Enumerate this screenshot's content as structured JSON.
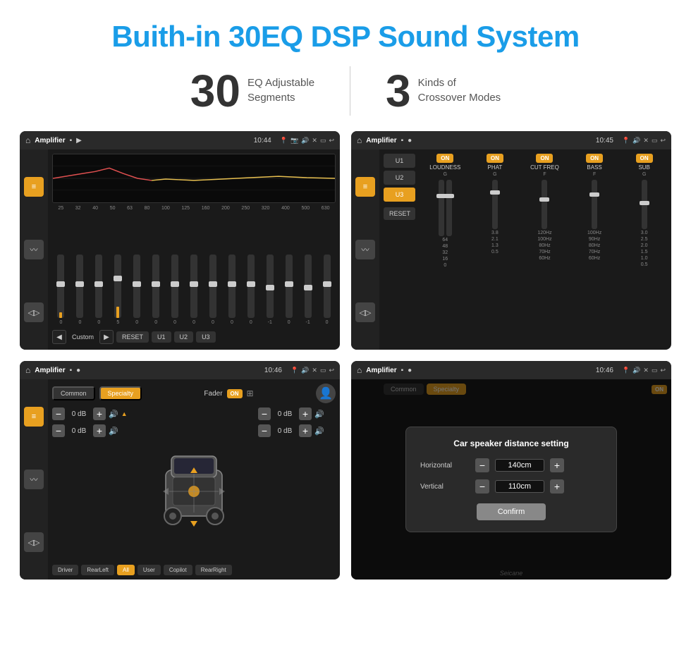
{
  "header": {
    "title": "Buith-in 30EQ DSP Sound System"
  },
  "stats": [
    {
      "number": "30",
      "text": "EQ Adjustable\nSegments"
    },
    {
      "number": "3",
      "text": "Kinds of\nCrossover Modes"
    }
  ],
  "screens": {
    "eq": {
      "topbar": {
        "title": "Amplifier",
        "time": "10:44"
      },
      "freq_labels": [
        "25",
        "32",
        "40",
        "50",
        "63",
        "80",
        "100",
        "125",
        "160",
        "200",
        "250",
        "320",
        "400",
        "500",
        "630"
      ],
      "values": [
        "0",
        "0",
        "0",
        "5",
        "0",
        "0",
        "0",
        "0",
        "0",
        "0",
        "0",
        "-1",
        "0",
        "-1"
      ],
      "buttons": [
        "RESET",
        "U1",
        "U2",
        "U3"
      ],
      "preset_label": "Custom"
    },
    "crossover": {
      "topbar": {
        "title": "Amplifier",
        "time": "10:45"
      },
      "presets": [
        "U1",
        "U2",
        "U3"
      ],
      "active_preset": "U3",
      "bands": [
        {
          "name": "LOUDNESS",
          "toggle": "ON"
        },
        {
          "name": "PHAT",
          "toggle": "ON"
        },
        {
          "name": "CUT FREQ",
          "toggle": "ON"
        },
        {
          "name": "BASS",
          "toggle": "ON"
        },
        {
          "name": "SUB",
          "toggle": "ON"
        }
      ],
      "reset_label": "RESET"
    },
    "fader": {
      "topbar": {
        "title": "Amplifier",
        "time": "10:46"
      },
      "tabs": [
        "Common",
        "Specialty"
      ],
      "active_tab": "Specialty",
      "fader_label": "Fader",
      "fader_on": "ON",
      "controls": {
        "front_left_db": "0 dB",
        "front_right_db": "0 dB",
        "rear_left_db": "0 dB",
        "rear_right_db": "0 dB"
      },
      "speaker_buttons": [
        "Driver",
        "RearLeft",
        "All",
        "User",
        "Copilot",
        "RearRight"
      ],
      "active_speaker": "All"
    },
    "dialog": {
      "topbar": {
        "title": "Amplifier",
        "time": "10:46"
      },
      "title": "Car speaker distance setting",
      "horizontal_label": "Horizontal",
      "horizontal_value": "140cm",
      "vertical_label": "Vertical",
      "vertical_value": "110cm",
      "confirm_label": "Confirm"
    }
  },
  "brand": "Seicane"
}
